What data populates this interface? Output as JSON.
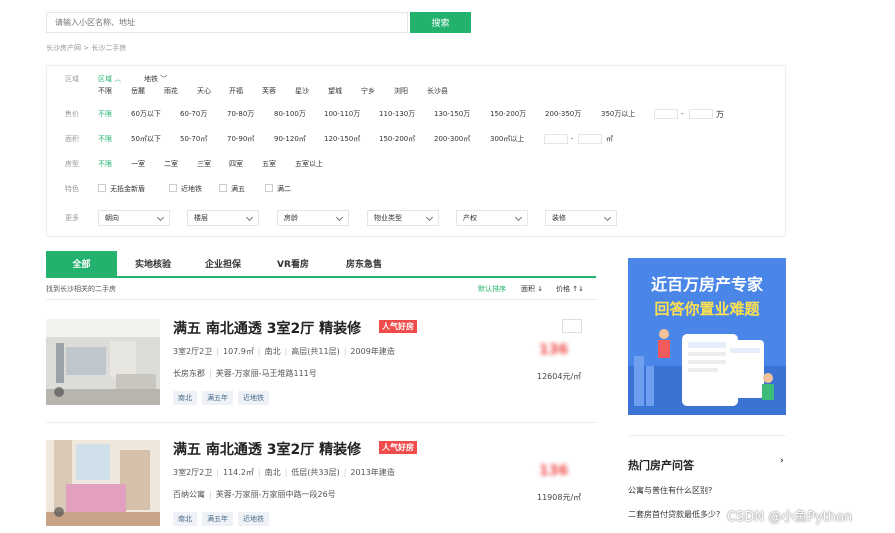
{
  "search": {
    "placeholder": "请输入小区名称、地址",
    "button": "搜索"
  },
  "breadcrumb": "长沙房产网 > 长沙二手房",
  "filters": {
    "area": {
      "label": "区域",
      "tab1": "区域",
      "tab2": "地铁",
      "items": [
        "不限",
        "岳麓",
        "雨花",
        "天心",
        "开福",
        "芙蓉",
        "星沙",
        "望城",
        "宁乡",
        "浏阳",
        "长沙县"
      ]
    },
    "price": {
      "label": "售价",
      "items": [
        "不限",
        "60万以下",
        "60-70万",
        "70-80万",
        "80-100万",
        "100-110万",
        "110-130万",
        "130-150万",
        "150-200万",
        "200-350万",
        "350万以上"
      ],
      "dash": "-",
      "unit": "万"
    },
    "size": {
      "label": "面积",
      "items": [
        "不限",
        "50㎡以下",
        "50-70㎡",
        "70-90㎡",
        "90-120㎡",
        "120-150㎡",
        "150-200㎡",
        "200-300㎡",
        "300㎡以上"
      ],
      "dash": "-",
      "unit": "㎡"
    },
    "layout": {
      "label": "房型",
      "items": [
        "不限",
        "一室",
        "二室",
        "三室",
        "四室",
        "五室",
        "五室以上"
      ]
    },
    "feature": {
      "label": "特色",
      "items": [
        "无抵金新盾",
        "近地铁",
        "满五",
        "满二"
      ]
    },
    "more": {
      "label": "更多",
      "selects": [
        "朝向",
        "楼层",
        "房龄",
        "物业类型",
        "产权",
        "装修"
      ]
    }
  },
  "tabs": [
    "全部",
    "实地核验",
    "企业担保",
    "VR看房",
    "房东急售"
  ],
  "found_text": "找到长沙相关的二手房",
  "sort": {
    "default": "默认排序",
    "area": "面积 ↓",
    "price": "价格 ↑↓"
  },
  "listings": [
    {
      "title": "满五 南北通透 3室2厅 精装修",
      "badge": "人气好房",
      "layout": "3室2厅2卫",
      "area": "107.9㎡",
      "orient": "南北",
      "floor": "高层(共11层)",
      "year": "2009年建造",
      "community": "长房东郡",
      "address": "芙蓉-万家丽-马王堆路111号",
      "tags": [
        "南北",
        "满五年",
        "近地铁"
      ],
      "price": "136",
      "unit_price": "12604元/㎡"
    },
    {
      "title": "满五 南北通透 3室2厅 精装修",
      "badge": "人气好房",
      "layout": "3室2厅2卫",
      "area": "114.2㎡",
      "orient": "南北",
      "floor": "低层(共33层)",
      "year": "2013年建造",
      "community": "百纳公寓",
      "address": "芙蓉-万家丽-万家丽中路一段26号",
      "tags": [
        "南北",
        "满五年",
        "近地铁"
      ],
      "price": "136",
      "unit_price": "11908元/㎡"
    }
  ],
  "ad": {
    "line1": "近百万房产专家",
    "line2": "回答你置业难题"
  },
  "qa": {
    "title": "热门房产问答",
    "items": [
      "公寓与普住有什么区别?",
      "二套房首付贷款最低多少?"
    ]
  },
  "watermark": "CSDN @小鱼Python",
  "colors": {
    "accent": "#22b26d",
    "badge": "#f04c4c",
    "ad_bg": "#4a86e8"
  }
}
